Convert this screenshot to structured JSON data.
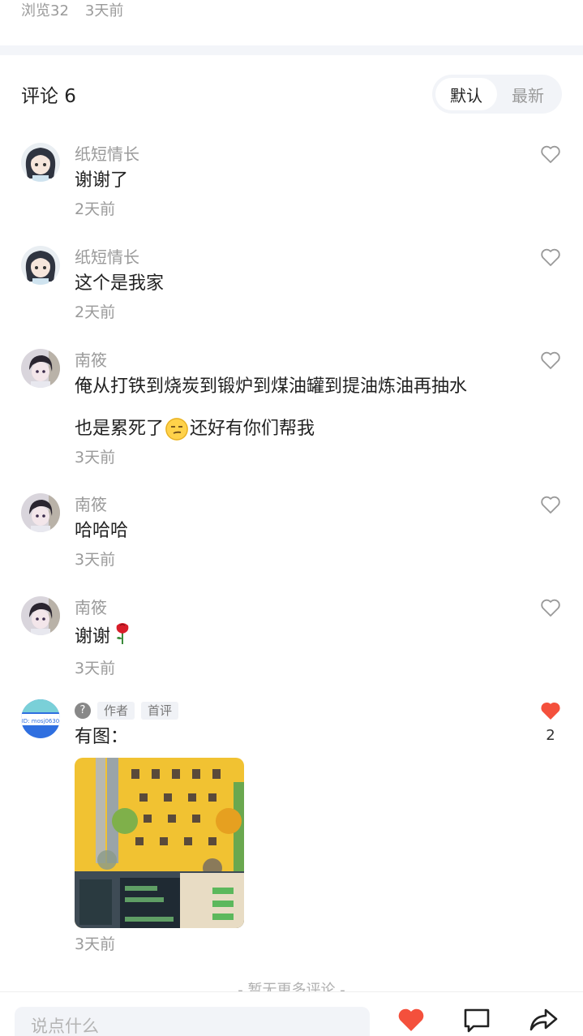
{
  "post_meta": {
    "views": "浏览32",
    "time": "3天前"
  },
  "comments_section": {
    "title": "评论 6",
    "sort_options": [
      {
        "label": "默认",
        "active": true
      },
      {
        "label": "最新",
        "active": false
      }
    ]
  },
  "comments": [
    {
      "author": "纸短情长",
      "lines": [
        "谢谢了"
      ],
      "time": "2天前"
    },
    {
      "author": "纸短情长",
      "lines": [
        "这个是我家"
      ],
      "time": "2天前"
    },
    {
      "author": "南筱",
      "lines": [
        "俺从打铁到烧炭到锻炉到煤油罐到提油炼油再抽水",
        "也是累死了",
        "还好有你们帮我"
      ],
      "emoji": "smirk-face",
      "time": "3天前"
    },
    {
      "author": "南筱",
      "lines": [
        "哈哈哈"
      ],
      "time": "3天前"
    },
    {
      "author": "南筱",
      "lines": [
        "谢谢"
      ],
      "emoji": "rose",
      "time": "3天前"
    },
    {
      "author": "",
      "tags": [
        "作者",
        "首评"
      ],
      "lines": [
        "有图："
      ],
      "time": "3天前",
      "liked": true,
      "like_count": "2",
      "avatar_text": "ID:  mosj0630"
    }
  ],
  "footer": {
    "no_more": "- 暂无更多评论 -",
    "input_placeholder": "说点什么",
    "like_color": "#f4503c"
  },
  "icons": [
    "heart-outline-icon",
    "heart-filled-icon",
    "comment-icon",
    "share-icon",
    "unknown-glyph-icon"
  ]
}
